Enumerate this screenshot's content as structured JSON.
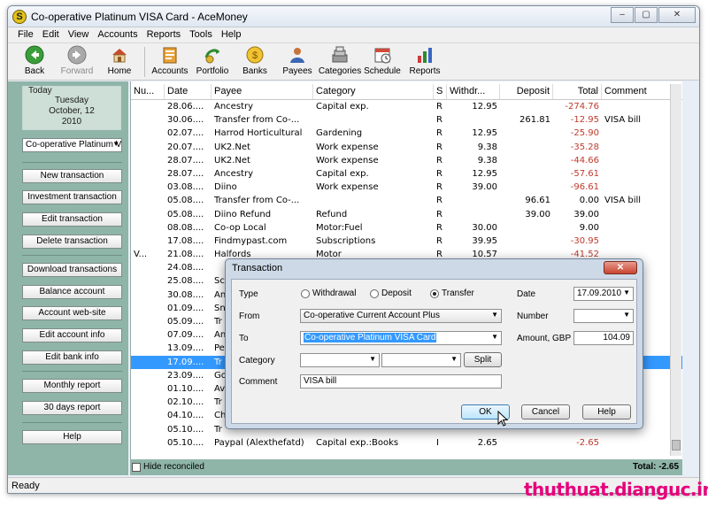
{
  "window": {
    "title": "Co-operative Platinum VISA Card - AceMoney",
    "app_icon": "S",
    "minimize": "–",
    "maximize": "▢",
    "close": "✕"
  },
  "menu": [
    "File",
    "Edit",
    "View",
    "Accounts",
    "Reports",
    "Tools",
    "Help"
  ],
  "toolbar": [
    {
      "label": "Back",
      "icon": "back-arrow-icon",
      "enabled": true
    },
    {
      "label": "Forward",
      "icon": "forward-arrow-icon",
      "enabled": false
    },
    {
      "label": "Home",
      "icon": "home-icon",
      "enabled": true
    },
    {
      "label": "Accounts",
      "icon": "accounts-icon",
      "enabled": true
    },
    {
      "label": "Portfolio",
      "icon": "portfolio-icon",
      "enabled": true
    },
    {
      "label": "Banks",
      "icon": "banks-icon",
      "enabled": true
    },
    {
      "label": "Payees",
      "icon": "payees-icon",
      "enabled": true
    },
    {
      "label": "Categories",
      "icon": "categories-icon",
      "enabled": true
    },
    {
      "label": "Schedule",
      "icon": "schedule-icon",
      "enabled": true
    },
    {
      "label": "Reports",
      "icon": "reports-icon",
      "enabled": true
    }
  ],
  "sidebar": {
    "today_label": "Today",
    "today_day": "Tuesday",
    "today_date": "October, 12",
    "today_year": "2010",
    "account": "Co-operative Platinum VISA",
    "buttons": [
      "New transaction",
      "Investment transaction",
      "Edit transaction",
      "Delete transaction",
      "Download transactions",
      "Balance account",
      "Account web-site",
      "Edit account info",
      "Edit bank info",
      "Monthly report",
      "30 days report",
      "Help"
    ]
  },
  "table": {
    "columns": [
      "Nu...",
      "Date",
      "Payee",
      "Category",
      "S",
      "Withdr...",
      "Deposit",
      "Total",
      "Comment"
    ],
    "rows": [
      {
        "num": "",
        "date": "28.06....",
        "payee": "Ancestry",
        "category": "Capital exp.",
        "s": "R",
        "withdrawal": "12.95",
        "deposit": "",
        "total": "-274.76",
        "comment": ""
      },
      {
        "num": "",
        "date": "30.06....",
        "payee": "Transfer from Co-...",
        "category": "",
        "s": "R",
        "withdrawal": "",
        "deposit": "261.81",
        "total": "-12.95",
        "comment": "VISA bill"
      },
      {
        "num": "",
        "date": "02.07....",
        "payee": "Harrod Horticultural",
        "category": "Gardening",
        "s": "R",
        "withdrawal": "12.95",
        "deposit": "",
        "total": "-25.90",
        "comment": ""
      },
      {
        "num": "",
        "date": "20.07....",
        "payee": "UK2.Net",
        "category": "Work expense",
        "s": "R",
        "withdrawal": "9.38",
        "deposit": "",
        "total": "-35.28",
        "comment": ""
      },
      {
        "num": "",
        "date": "28.07....",
        "payee": "UK2.Net",
        "category": "Work expense",
        "s": "R",
        "withdrawal": "9.38",
        "deposit": "",
        "total": "-44.66",
        "comment": ""
      },
      {
        "num": "",
        "date": "28.07....",
        "payee": "Ancestry",
        "category": "Capital exp.",
        "s": "R",
        "withdrawal": "12.95",
        "deposit": "",
        "total": "-57.61",
        "comment": ""
      },
      {
        "num": "",
        "date": "03.08....",
        "payee": "Diino",
        "category": "Work expense",
        "s": "R",
        "withdrawal": "39.00",
        "deposit": "",
        "total": "-96.61",
        "comment": ""
      },
      {
        "num": "",
        "date": "05.08....",
        "payee": "Transfer from Co-...",
        "category": "",
        "s": "R",
        "withdrawal": "",
        "deposit": "96.61",
        "total": "0.00",
        "comment": "VISA bill"
      },
      {
        "num": "",
        "date": "05.08....",
        "payee": "Diino Refund",
        "category": "Refund",
        "s": "R",
        "withdrawal": "",
        "deposit": "39.00",
        "total": "39.00",
        "comment": ""
      },
      {
        "num": "",
        "date": "08.08....",
        "payee": "Co-op Local",
        "category": "Motor:Fuel",
        "s": "R",
        "withdrawal": "30.00",
        "deposit": "",
        "total": "9.00",
        "comment": ""
      },
      {
        "num": "",
        "date": "17.08....",
        "payee": "Findmypast.com",
        "category": "Subscriptions",
        "s": "R",
        "withdrawal": "39.95",
        "deposit": "",
        "total": "-30.95",
        "comment": ""
      },
      {
        "num": "V...",
        "date": "21.08....",
        "payee": "Halfords",
        "category": "Motor",
        "s": "R",
        "withdrawal": "10.57",
        "deposit": "",
        "total": "-41.52",
        "comment": ""
      },
      {
        "num": "",
        "date": "24.08....",
        "payee": "",
        "category": "",
        "s": "",
        "withdrawal": "",
        "deposit": "",
        "total": "",
        "comment": ""
      },
      {
        "num": "",
        "date": "25.08....",
        "payee": "Sc",
        "category": "",
        "s": "",
        "withdrawal": "",
        "deposit": "",
        "total": "",
        "comment": ""
      },
      {
        "num": "",
        "date": "30.08....",
        "payee": "An",
        "category": "",
        "s": "",
        "withdrawal": "",
        "deposit": "",
        "total": "",
        "comment": ""
      },
      {
        "num": "",
        "date": "01.09....",
        "payee": "Sn",
        "category": "",
        "s": "",
        "withdrawal": "",
        "deposit": "",
        "total": "",
        "comment": ""
      },
      {
        "num": "",
        "date": "05.09....",
        "payee": "Tr",
        "category": "",
        "s": "",
        "withdrawal": "",
        "deposit": "",
        "total": "",
        "comment": ""
      },
      {
        "num": "",
        "date": "07.09....",
        "payee": "An",
        "category": "",
        "s": "",
        "withdrawal": "",
        "deposit": "",
        "total": "",
        "comment": ""
      },
      {
        "num": "",
        "date": "13.09....",
        "payee": "Pe",
        "category": "",
        "s": "",
        "withdrawal": "",
        "deposit": "",
        "total": "",
        "comment": ""
      },
      {
        "num": "",
        "date": "17.09....",
        "payee": "Tr",
        "category": "",
        "s": "",
        "withdrawal": "",
        "deposit": "",
        "total": "",
        "comment": "",
        "selected": true
      },
      {
        "num": "",
        "date": "23.09....",
        "payee": "Go",
        "category": "",
        "s": "",
        "withdrawal": "",
        "deposit": "",
        "total": "",
        "comment": ""
      },
      {
        "num": "",
        "date": "01.10....",
        "payee": "Av",
        "category": "",
        "s": "",
        "withdrawal": "",
        "deposit": "",
        "total": "",
        "comment": ""
      },
      {
        "num": "",
        "date": "02.10....",
        "payee": "Tr",
        "category": "",
        "s": "",
        "withdrawal": "",
        "deposit": "",
        "total": "",
        "comment": ""
      },
      {
        "num": "",
        "date": "04.10....",
        "payee": "Ch",
        "category": "",
        "s": "",
        "withdrawal": "",
        "deposit": "",
        "total": "",
        "comment": ""
      },
      {
        "num": "",
        "date": "05.10....",
        "payee": "Tr",
        "category": "",
        "s": "",
        "withdrawal": "",
        "deposit": "",
        "total": "",
        "comment": ""
      },
      {
        "num": "",
        "date": "05.10....",
        "payee": "Paypal (Alexthefatd)",
        "category": "Capital exp.:Books",
        "s": "I",
        "withdrawal": "2.65",
        "deposit": "",
        "total": "-2.65",
        "comment": ""
      }
    ]
  },
  "footer": {
    "hide_reconciled": "Hide reconciled",
    "total": "Total: -2.65"
  },
  "status": "Ready",
  "watermark": "thuthuat.dianguc.info",
  "dialog": {
    "title": "Transaction",
    "type_label": "Type",
    "types": [
      "Withdrawal",
      "Deposit",
      "Transfer"
    ],
    "selected_type": "Transfer",
    "from_label": "From",
    "from_value": "Co-operative Current Account Plus",
    "to_label": "To",
    "to_value": "Co-operative Platinum VISA Card",
    "category_label": "Category",
    "category_value": "",
    "subcategory_value": "",
    "split_label": "Split",
    "comment_label": "Comment",
    "comment_value": "VISA bill",
    "date_label": "Date",
    "date_value": "17.09.2010",
    "number_label": "Number",
    "number_value": "",
    "amount_label": "Amount, GBP",
    "amount_value": "104.09",
    "ok_label": "OK",
    "cancel_label": "Cancel",
    "help_label": "Help",
    "close_glyph": "✕"
  },
  "colors": {
    "sidebar_bg": "#8fb5a8",
    "selection": "#3399ff",
    "negative": "#c0392b",
    "watermark": "#e6007a"
  }
}
